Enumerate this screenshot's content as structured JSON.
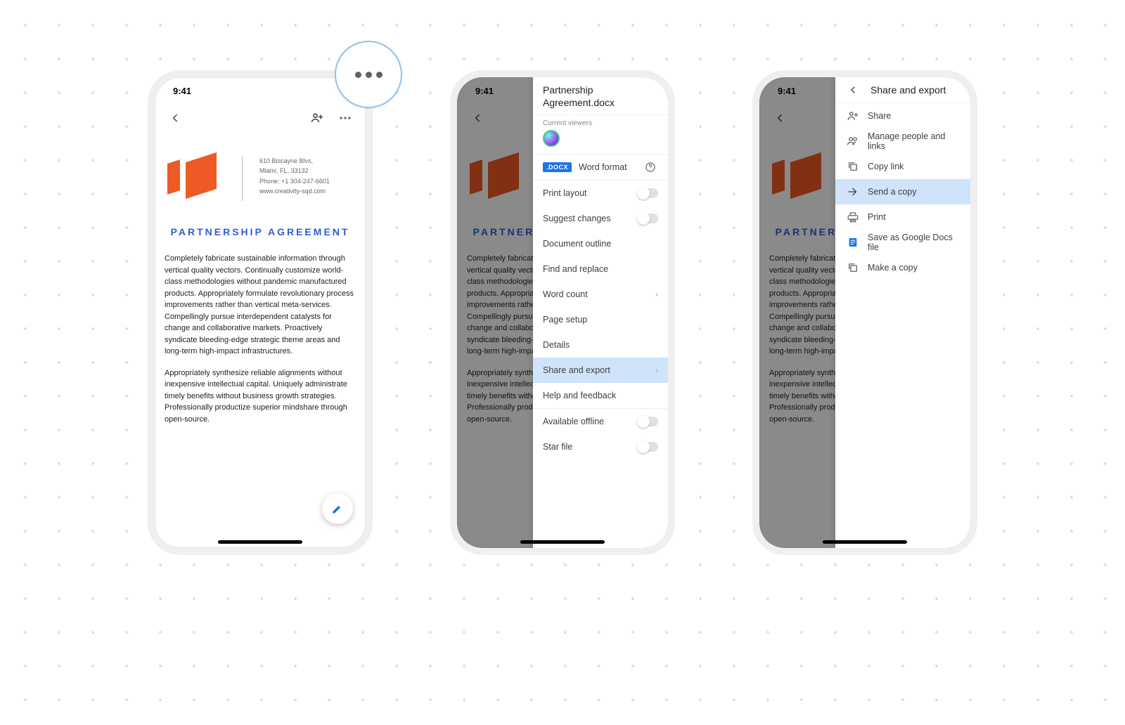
{
  "status": {
    "time": "9:41"
  },
  "doc": {
    "title": "PARTNERSHIP AGREEMENT",
    "addr1": "610 Biscayne Blvs,",
    "addr2": "Miami, FL, 33132",
    "addr3": "Phone: +1 304-247-6601",
    "addr4": "www.creativity-sqd.com",
    "p1": "Completely fabricate sustainable information through vertical quality vectors. Continually customize world-class methodologies without pandemic manufactured products. Appropriately formulate revolutionary process improvements rather than vertical meta-services. Compellingly pursue interdependent catalysts for change and collaborative markets. Proactively syndicate bleeding-edge strategic theme areas and long-term high-impact infrastructures.",
    "p2": "Appropriately synthesize reliable alignments without inexpensive intellectual capital. Uniquely administrate timely benefits without business growth strategies. Professionally productize superior mindshare through open-source."
  },
  "drawer": {
    "file_title": "Partnership Agreement.docx",
    "viewers_label": "Current viewers",
    "docx_chip": ".DOCX",
    "word_format": "Word format",
    "items": {
      "print_layout": "Print layout",
      "suggest": "Suggest changes",
      "outline": "Document outline",
      "find": "Find and replace",
      "wordcount": "Word count",
      "pagesetup": "Page setup",
      "details": "Details",
      "share_export": "Share and export",
      "help": "Help and feedback",
      "offline": "Available offline",
      "star": "Star file"
    }
  },
  "share": {
    "title": "Share and export",
    "items": {
      "share": "Share",
      "manage": "Manage people and links",
      "copylink": "Copy link",
      "sendcopy": "Send a copy",
      "print": "Print",
      "saveas": "Save as Google Docs file",
      "makecopy": "Make a copy"
    }
  }
}
